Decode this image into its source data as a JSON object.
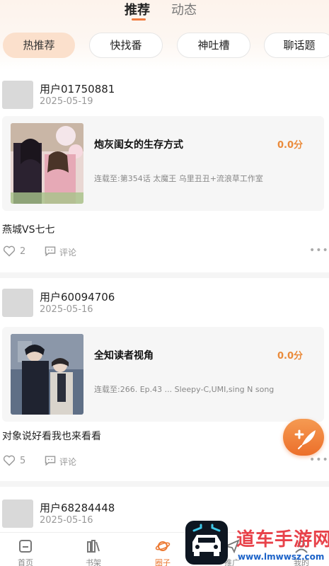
{
  "top_tabs": [
    {
      "label": "推荐",
      "active": true
    },
    {
      "label": "动态",
      "active": false
    }
  ],
  "chips": [
    {
      "label": "热推荐",
      "active": true
    },
    {
      "label": "快找番",
      "active": false
    },
    {
      "label": "神吐槽",
      "active": false
    },
    {
      "label": "聊话题",
      "active": false
    }
  ],
  "posts": [
    {
      "user": "用户01750881",
      "date": "2025-05-19",
      "book_title": "炮灰闺女的生存方式",
      "score": "0.0分",
      "status": "连载至:第354话 太魔王 乌里丑丑+流浪草工作室",
      "text": "燕城VS七七",
      "likes": "2",
      "comment_label": "评论"
    },
    {
      "user": "用户60094706",
      "date": "2025-05-16",
      "book_title": "全知读者视角",
      "score": "0.0分",
      "status": "连载至:266. Ep.43 ... Sleepy-C,UMI,sing N song",
      "text": "对象说好看我也来看看",
      "likes": "5",
      "comment_label": "评论"
    },
    {
      "user": "用户68284448",
      "date": "2025-05-16"
    }
  ],
  "bottom_nav": [
    {
      "label": "首页",
      "icon": "home-icon",
      "active": false
    },
    {
      "label": "书架",
      "icon": "bookshelf-icon",
      "active": false
    },
    {
      "label": "圈子",
      "icon": "planet-icon",
      "active": true
    },
    {
      "label": "推广",
      "icon": "plane-icon",
      "active": false
    },
    {
      "label": "我的",
      "icon": "profile-icon",
      "active": false
    }
  ],
  "watermark": {
    "title": "道车手游网",
    "url": "www.lmwwsz.com"
  },
  "colors": {
    "accent": "#ec7a34",
    "score": "#ea8a3a",
    "chip_active": "#fbe0cc"
  }
}
